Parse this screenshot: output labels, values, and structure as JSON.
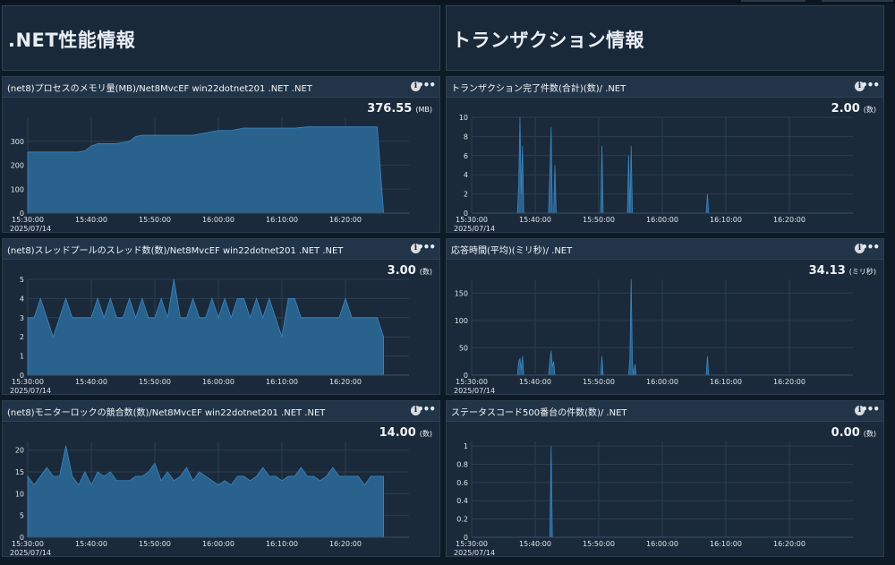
{
  "headers": [
    {
      "title": ".NET性能情報"
    },
    {
      "title": "トランザクション情報"
    }
  ],
  "colors": {
    "area_fill": "#2a628e",
    "area_line": "#3b86c2",
    "grid": "#2c3e4f"
  },
  "icons": {
    "info": "info-icon",
    "more": "more-dots-icon"
  },
  "panels": [
    {
      "title": "(net8)プロセスのメモリ量(MB)/Net8MvcEF win22dotnet201 .NET .NET",
      "value": "376.55",
      "unit": "(MB)",
      "chart_data": {
        "type": "area",
        "x": [
          0,
          2,
          4,
          6,
          8,
          9,
          10,
          11,
          12,
          14,
          16,
          17,
          18,
          19,
          20,
          22,
          24,
          26,
          28,
          30,
          32,
          34,
          36,
          38,
          40,
          42,
          44,
          46,
          48,
          50,
          52,
          54,
          55,
          56
        ],
        "values": [
          255,
          255,
          255,
          255,
          255,
          260,
          280,
          290,
          290,
          290,
          300,
          320,
          325,
          325,
          325,
          325,
          325,
          325,
          335,
          345,
          345,
          355,
          355,
          355,
          355,
          355,
          360,
          360,
          360,
          360,
          360,
          360,
          360,
          0
        ],
        "ylim": [
          0,
          400
        ],
        "yticks": [
          "0",
          "100",
          "200",
          "300"
        ],
        "ytick_values": [
          0,
          100,
          200,
          300
        ],
        "xticks": [
          "15:30:00",
          "15:40:00",
          "15:50:00",
          "16:00:00",
          "16:10:00",
          "16:20:00"
        ],
        "xtick_values": [
          0,
          10,
          20,
          30,
          40,
          50
        ],
        "date": "2025/07/14"
      }
    },
    {
      "title": "トランザクション完了件数(合計)(数)/ .NET",
      "value": "2.00",
      "unit": "(数)",
      "chart_data": {
        "type": "area",
        "x": [
          0,
          7.2,
          7.4,
          7.6,
          7.8,
          8.0,
          8.2,
          12.1,
          12.3,
          12.5,
          12.7,
          12.9,
          13.1,
          13.3,
          13.5,
          20.3,
          20.5,
          20.7,
          24.5,
          24.7,
          24.9,
          25.1,
          25.3,
          25.5,
          25.7,
          36.9,
          37.1,
          37.3,
          56
        ],
        "values": [
          0,
          0,
          3,
          10,
          2,
          7,
          0,
          0,
          4,
          9,
          0,
          0,
          5,
          0,
          0,
          0,
          7,
          0,
          0,
          6,
          0,
          7,
          0,
          0,
          0,
          0,
          2,
          0,
          0
        ],
        "ylim": [
          0,
          10
        ],
        "yticks": [
          "0",
          "2",
          "4",
          "6",
          "8",
          "10"
        ],
        "ytick_values": [
          0,
          2,
          4,
          6,
          8,
          10
        ],
        "xticks": [
          "15:30:00",
          "15:40:00",
          "15:50:00",
          "16:00:00",
          "16:10:00",
          "16:20:00"
        ],
        "xtick_values": [
          0,
          10,
          20,
          30,
          40,
          50
        ],
        "date": "2025/07/14"
      }
    },
    {
      "title": "(net8)スレッドプールのスレッド数(数)/Net8MvcEF win22dotnet201 .NET .NET",
      "value": "3.00",
      "unit": "(数)",
      "chart_data": {
        "type": "area",
        "x": [
          0,
          1,
          2,
          3,
          4,
          5,
          6,
          7,
          8,
          9,
          10,
          11,
          12,
          13,
          14,
          15,
          16,
          17,
          18,
          19,
          20,
          21,
          22,
          23,
          24,
          25,
          26,
          27,
          28,
          29,
          30,
          31,
          32,
          33,
          34,
          35,
          36,
          37,
          38,
          39,
          40,
          41,
          42,
          43,
          44,
          45,
          46,
          47,
          48,
          49,
          50,
          51,
          52,
          53,
          54,
          55,
          56
        ],
        "values": [
          3,
          3,
          4,
          3,
          2,
          3,
          4,
          3,
          3,
          3,
          3,
          4,
          3,
          4,
          3,
          3,
          4,
          3,
          4,
          3,
          3,
          4,
          3,
          5,
          3,
          3,
          4,
          3,
          3,
          4,
          3,
          4,
          3,
          4,
          4,
          3,
          4,
          3,
          4,
          3,
          2,
          4,
          4,
          3,
          3,
          3,
          3,
          3,
          3,
          3,
          4,
          3,
          3,
          3,
          3,
          3,
          2,
          3,
          0
        ],
        "ylim": [
          0,
          5
        ],
        "yticks": [
          "0",
          "1",
          "2",
          "3",
          "4",
          "5"
        ],
        "ytick_values": [
          0,
          1,
          2,
          3,
          4,
          5
        ],
        "xticks": [
          "15:30:00",
          "15:40:00",
          "15:50:00",
          "16:00:00",
          "16:10:00",
          "16:20:00"
        ],
        "xtick_values": [
          0,
          10,
          20,
          30,
          40,
          50
        ],
        "date": "2025/07/14"
      }
    },
    {
      "title": "応答時間(平均)(ミリ秒)/ .NET",
      "value": "34.13",
      "unit": "(ミリ秒)",
      "chart_data": {
        "type": "area",
        "x": [
          0,
          7.2,
          7.4,
          7.6,
          7.8,
          8.0,
          8.2,
          12.1,
          12.3,
          12.5,
          12.7,
          12.9,
          13.1,
          20.3,
          20.5,
          20.7,
          24.7,
          24.9,
          25.1,
          25.3,
          25.5,
          25.7,
          25.9,
          36.9,
          37.1,
          37.3,
          56
        ],
        "values": [
          0,
          0,
          25,
          30,
          10,
          35,
          0,
          0,
          25,
          45,
          15,
          25,
          0,
          0,
          35,
          0,
          0,
          30,
          175,
          20,
          0,
          20,
          0,
          0,
          35,
          0,
          0
        ],
        "ylim": [
          0,
          175
        ],
        "yticks": [
          "0",
          "50",
          "100",
          "150"
        ],
        "ytick_values": [
          0,
          50,
          100,
          150
        ],
        "xticks": [
          "15:30:00",
          "15:40:00",
          "15:50:00",
          "16:00:00",
          "16:10:00",
          "16:20:00"
        ],
        "xtick_values": [
          0,
          10,
          20,
          30,
          40,
          50
        ],
        "date": "2025/07/14"
      }
    },
    {
      "title": "(net8)モニターロックの競合数(数)/Net8MvcEF win22dotnet201 .NET .NET",
      "value": "14.00",
      "unit": "(数)",
      "chart_data": {
        "type": "area",
        "x": [
          0,
          1,
          2,
          3,
          4,
          5,
          6,
          7,
          8,
          9,
          10,
          11,
          12,
          13,
          14,
          15,
          16,
          17,
          18,
          19,
          20,
          21,
          22,
          23,
          24,
          25,
          26,
          27,
          28,
          29,
          30,
          31,
          32,
          33,
          34,
          35,
          36,
          37,
          38,
          39,
          40,
          41,
          42,
          43,
          44,
          45,
          46,
          47,
          48,
          49,
          50,
          51,
          52,
          53,
          54,
          55,
          56
        ],
        "values": [
          14,
          12,
          14,
          16,
          14,
          14,
          21,
          14,
          12,
          15,
          12,
          15,
          14,
          15,
          13,
          13,
          13,
          14,
          14,
          15,
          17,
          13,
          15,
          13,
          14,
          16,
          13,
          15,
          14,
          13,
          12,
          13,
          12,
          14,
          14,
          13,
          14,
          16,
          14,
          14,
          13,
          14,
          14,
          16,
          14,
          14,
          13,
          14,
          16,
          14,
          14,
          14,
          14,
          12,
          14,
          14,
          14,
          0
        ],
        "ylim": [
          0,
          22
        ],
        "yticks": [
          "0",
          "5",
          "10",
          "15",
          "20"
        ],
        "ytick_values": [
          0,
          5,
          10,
          15,
          20
        ],
        "xticks": [
          "15:30:00",
          "15:40:00",
          "15:50:00",
          "16:00:00",
          "16:10:00",
          "16:20:00"
        ],
        "xtick_values": [
          0,
          10,
          20,
          30,
          40,
          50
        ],
        "date": "2025/07/14"
      }
    },
    {
      "title": "ステータスコード500番台の件数(数)/ .NET",
      "value": "0.00",
      "unit": "(数)",
      "chart_data": {
        "type": "area",
        "x": [
          0,
          12.3,
          12.5,
          12.7,
          56
        ],
        "values": [
          0,
          0,
          1,
          0,
          0
        ],
        "ylim": [
          0,
          1.05
        ],
        "yticks": [
          "0",
          "0.2",
          "0.4",
          "0.6",
          "0.8",
          "1"
        ],
        "ytick_values": [
          0,
          0.2,
          0.4,
          0.6,
          0.8,
          1
        ],
        "xticks": [
          "15:30:00",
          "15:40:00",
          "15:50:00",
          "16:00:00",
          "16:10:00",
          "16:20:00"
        ],
        "xtick_values": [
          0,
          10,
          20,
          30,
          40,
          50
        ],
        "date": "2025/07/14"
      }
    }
  ]
}
